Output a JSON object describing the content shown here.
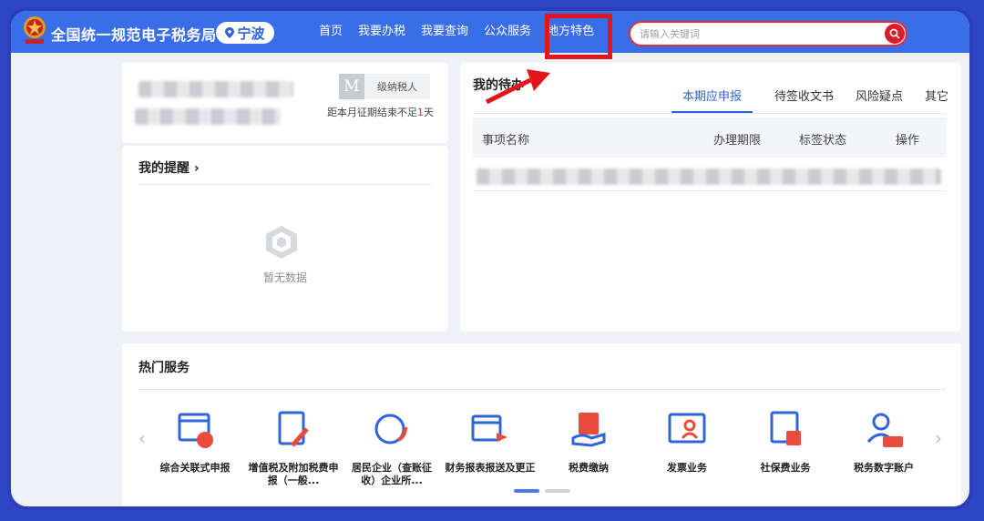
{
  "header": {
    "site_title": "全国统一规范电子税务局",
    "location": "宁波",
    "nav": [
      "首页",
      "我要办税",
      "我要查询",
      "公众服务",
      "地方特色"
    ],
    "search_placeholder": "请输入关键词",
    "bg_color": "#3a6de8"
  },
  "taxpayer_card": {
    "badge_letter": "M",
    "badge_label": "级纳税人",
    "deadline_prefix": "距本月征期结束不足",
    "deadline_days": "1",
    "deadline_suffix": "天"
  },
  "reminders": {
    "title": "我的提醒 ›",
    "empty_text": "暂无数据"
  },
  "todo": {
    "title": "我的待办",
    "tabs": [
      "本期应申报",
      "待签收文书",
      "风险疑点",
      "其它"
    ],
    "active_tab": 0,
    "columns": [
      "事项名称",
      "办理期限",
      "标签状态",
      "操作"
    ]
  },
  "hot_services": {
    "title": "热门服务",
    "items": [
      {
        "label": "综合关联式申报",
        "icon": "desktop-icon"
      },
      {
        "label": "增值税及附加税费申报（一般...",
        "icon": "vat-icon"
      },
      {
        "label": "居民企业（查账征收）企业所...",
        "icon": "enterprise-icon"
      },
      {
        "label": "财务报表报送及更正",
        "icon": "report-icon"
      },
      {
        "label": "税费缴纳",
        "icon": "payment-icon"
      },
      {
        "label": "发票业务",
        "icon": "invoice-icon"
      },
      {
        "label": "社保费业务",
        "icon": "social-security-icon"
      },
      {
        "label": "税务数字账户",
        "icon": "digital-account-icon"
      }
    ],
    "prev": "‹",
    "next": "›"
  }
}
